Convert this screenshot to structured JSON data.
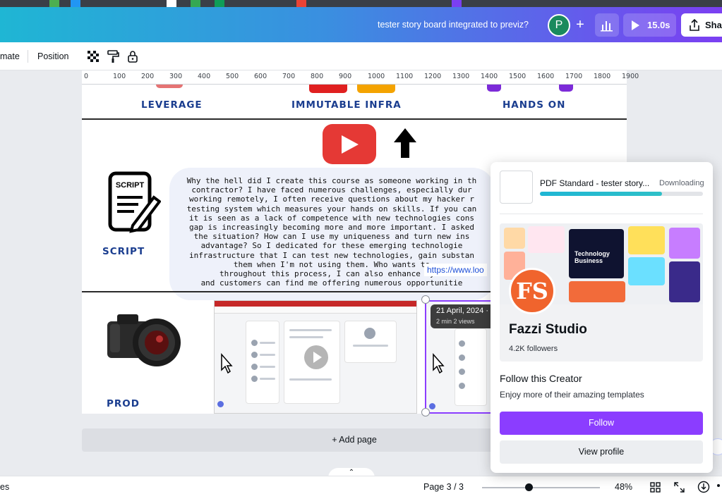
{
  "header": {
    "doc_title": "tester story board integrated to previz?",
    "avatar_initial": "P",
    "add_label": "+",
    "play_time": "15.0s",
    "share_label": "Shar"
  },
  "toolbar": {
    "animate_label": "mate",
    "position_label": "Position"
  },
  "ruler": {
    "labels": [
      "0",
      "100",
      "200",
      "300",
      "400",
      "500",
      "600",
      "700",
      "800",
      "900",
      "1000",
      "1100",
      "1200",
      "1300",
      "1400",
      "1500",
      "1600",
      "1700",
      "1800",
      "1900"
    ]
  },
  "canvas": {
    "headings": {
      "leverage": "LEVERAGE",
      "immutable": "IMMUTABLE INFRA",
      "hands_on": "HANDS ON"
    },
    "script_icon_text": "SCRIPT",
    "script_label": "SCRIPT",
    "prod_label": "PROD",
    "script_lines": [
      "Why the hell did I create this course as someone working in th",
      "contractor? I have faced numerous challenges, especially dur",
      "working remotely, I often receive questions about my hacker r",
      "testing system which measures your hands on skills. If you can",
      "it is seen as a lack of competence with new technologies cons",
      "gap is increasingly becoming more and more important. I asked",
      "the situation? How can I use my uniqueness and turn new ins",
      "advantage? So I dedicated for these emerging technologie",
      "infrastructure that I can test new technologies, gain substan",
      "them when I'm not using them. Who wants to",
      "throughout this process, I can also enhance my c",
      "and customers can find me offering numerous opportunitie"
    ],
    "link_text": "https://www.loo",
    "video_date": "21 April, 2024 · 1",
    "video_meta": "2 min   2 views"
  },
  "add_page_label": "+ Add page",
  "bottom": {
    "left_label": "es",
    "page_indicator": "Page 3 / 3",
    "zoom_value": "48%",
    "zoom_fraction": 0.4
  },
  "popover": {
    "download_name": "PDF Standard - tester story...",
    "download_status": "Downloading",
    "download_progress": 0.75,
    "creator_logo": "FS",
    "creator_name": "Fazzi Studio",
    "followers": "4.2K followers",
    "banner_text": "Technology Business",
    "follow_heading": "Follow this Creator",
    "follow_sub": "Enjoy more of their amazing templates",
    "follow_button": "Follow",
    "profile_button": "View profile"
  },
  "colors": {
    "accent": "#8b3dff",
    "heading_blue": "#1a3d8f",
    "youtube_red": "#e53935"
  }
}
